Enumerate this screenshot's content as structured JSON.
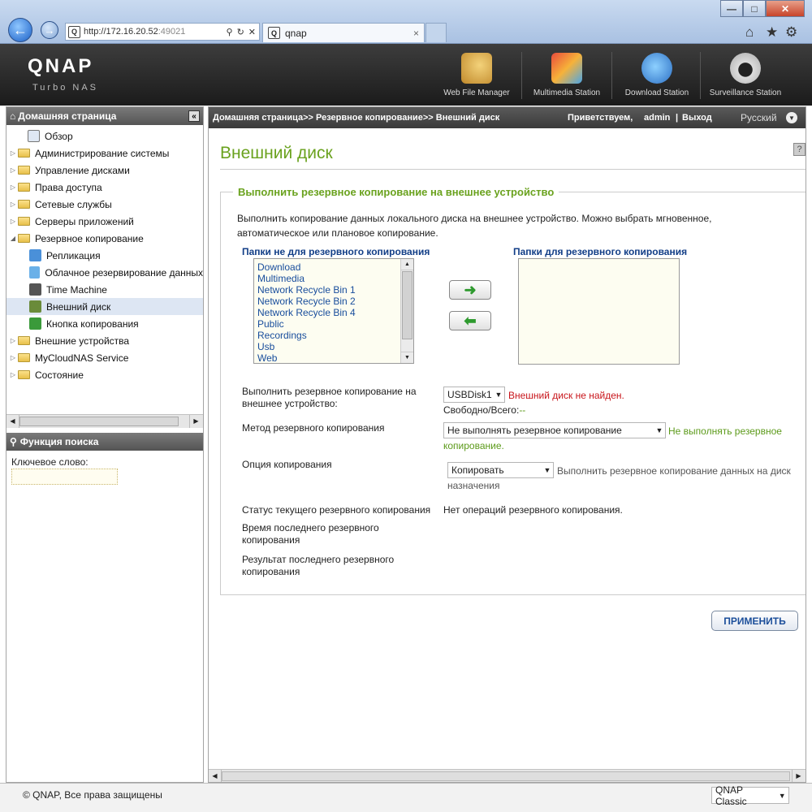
{
  "browser": {
    "url_host": "http://172.16.20.52",
    "url_port": ":49021",
    "tab_title": "qnap",
    "tab_close": "×",
    "window_buttons": [
      "—",
      "□",
      "✕"
    ],
    "right_icons": [
      "⌂",
      "★",
      "⚙"
    ]
  },
  "header": {
    "logo": "QNAP",
    "logo_sub": "Turbo NAS",
    "apps": [
      "Web File Manager",
      "Multimedia Station",
      "Download Station",
      "Surveillance Station"
    ]
  },
  "sidebar": {
    "home_label": "Домашняя страница",
    "collapse_icon": "«",
    "items": [
      {
        "label": "Обзор",
        "icon": "overview-icon",
        "level": 0
      },
      {
        "label": "Администрирование системы",
        "icon": "folder-icon",
        "level": 0
      },
      {
        "label": "Управление дисками",
        "icon": "folder-icon",
        "level": 0
      },
      {
        "label": "Права доступа",
        "icon": "folder-icon",
        "level": 0
      },
      {
        "label": "Сетевые службы",
        "icon": "folder-icon",
        "level": 0
      },
      {
        "label": "Серверы приложений",
        "icon": "folder-icon",
        "level": 0
      },
      {
        "label": "Резервное копирование",
        "icon": "folder-icon",
        "level": 0
      },
      {
        "label": "Репликация",
        "icon": "replication-icon",
        "level": 1
      },
      {
        "label": "Облачное резервирование данных",
        "icon": "cloud-icon",
        "level": 1
      },
      {
        "label": "Time Machine",
        "icon": "apple-icon",
        "level": 1
      },
      {
        "label": "Внешний диск",
        "icon": "usb-disk-icon",
        "level": 1
      },
      {
        "label": "Кнопка копирования",
        "icon": "copy-button-icon",
        "level": 1
      },
      {
        "label": "Внешние устройства",
        "icon": "folder-icon",
        "level": 0
      },
      {
        "label": "MyCloudNAS Service",
        "icon": "folder-icon",
        "level": 0
      },
      {
        "label": "Состояние",
        "icon": "folder-icon",
        "level": 0
      }
    ],
    "search_title": "Функция поиска",
    "keyword_label": "Ключевое слово:"
  },
  "top_bar": {
    "breadcrumb": "Домашняя страница>> Резервное копирование>> Внешний диск",
    "greeting": "Приветствуем,",
    "user": "admin",
    "divider": "|",
    "logout": "Выход",
    "language": "Русский"
  },
  "page": {
    "title": "Внешний диск",
    "help_icon": "?",
    "section_title": "Выполнить резервное копирование на внешнее устройство",
    "description": "Выполнить копирование данных локального диска на внешнее устройство. Можно выбрать мгновенное, автоматическое или плановое копирование.",
    "not_backup_label": "Папки не для резервного копирования",
    "backup_label": "Папки для резервного копирования",
    "not_backup_folders": [
      "Download",
      "Multimedia",
      "Network Recycle Bin 1",
      "Network Recycle Bin 2",
      "Network Recycle Bin 4",
      "Public",
      "Recordings",
      "Usb",
      "Web"
    ],
    "move_right_icon": "➜",
    "move_left_icon": "⬅",
    "backup_device_label": "Выполнить резервное копирование на внешнее устройство:",
    "device_value": "USBDisk1",
    "device_error": "Внешний диск не найден.",
    "free_total_label": "Свободно/Всего:",
    "free_total_value": "--",
    "method_label": "Метод резервного копирования",
    "method_value": "Не выполнять резервное копирование",
    "method_note": "Не выполнять резервное копирование.",
    "option_label": "Опция копирования",
    "option_value": "Копировать",
    "option_note": "Выполнить резервное копирование данных на диск назначения",
    "status_label": "Статус текущего резервного копирования",
    "status_value": "Нет операций резервного копирования.",
    "last_time_label": "Время последнего резервного копирования",
    "last_result_label": "Результат последнего резервного копирования",
    "apply_button": "ПРИМЕНИТЬ"
  },
  "footer": {
    "copyright": "© QNAP, Все права защищены",
    "theme": "QNAP Classic"
  },
  "colors": {
    "accent_green": "#6aa21e",
    "link_blue": "#184d9c",
    "error_red": "#c8151b"
  }
}
